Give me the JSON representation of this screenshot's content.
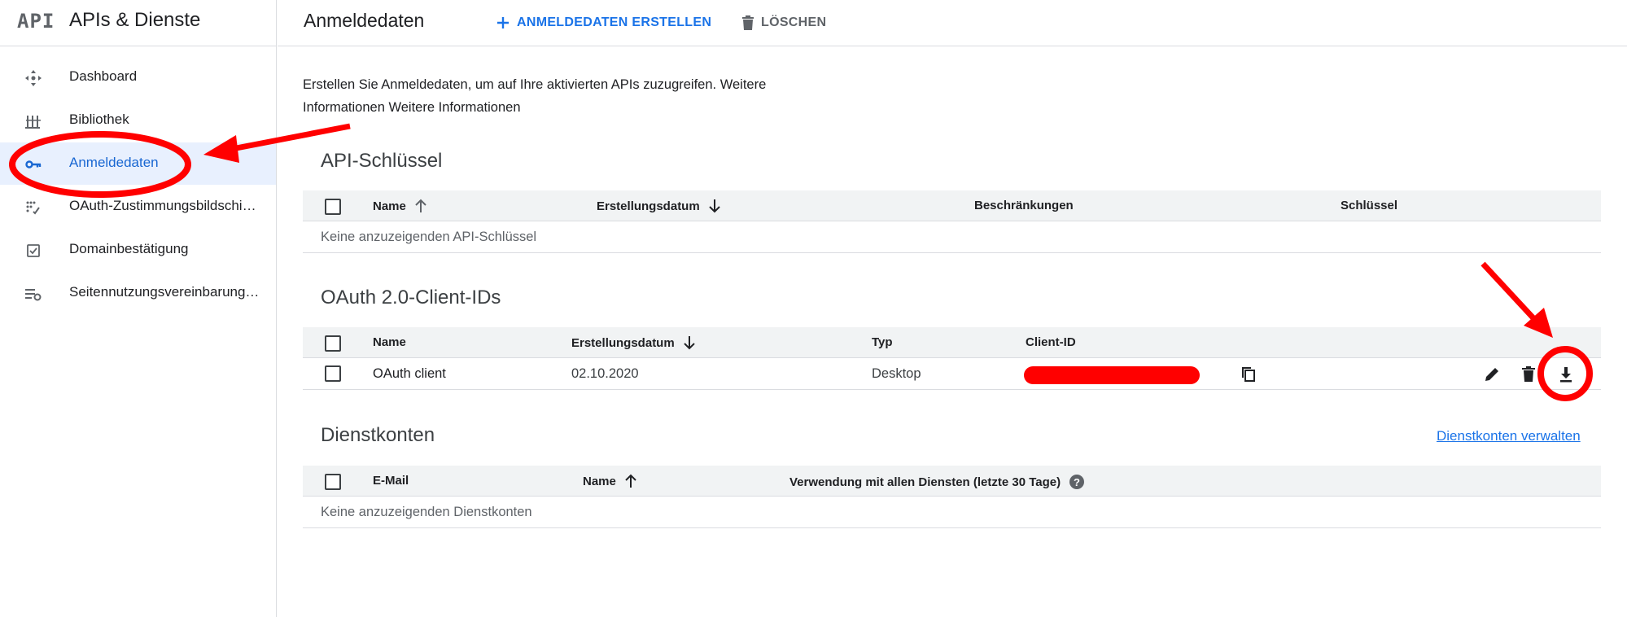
{
  "sidebar": {
    "logo": "API",
    "title": "APIs & Dienste",
    "items": [
      {
        "label": "Dashboard",
        "icon": "dashboard-icon"
      },
      {
        "label": "Bibliothek",
        "icon": "library-icon"
      },
      {
        "label": "Anmeldedaten",
        "icon": "key-icon",
        "active": true
      },
      {
        "label": "OAuth-Zustimmungsbildschi…",
        "icon": "oauth-consent-icon"
      },
      {
        "label": "Domainbestätigung",
        "icon": "checkbox-icon"
      },
      {
        "label": "Seitennutzungsvereinbarung…",
        "icon": "settings-list-icon"
      }
    ]
  },
  "header": {
    "title": "Anmeldedaten",
    "create_label": "ANMELDEDATEN ERSTELLEN",
    "delete_label": "LÖSCHEN"
  },
  "intro_text": "Erstellen Sie Anmeldedaten, um auf Ihre aktivierten APIs zuzugreifen. Weitere Informationen Weitere Informationen",
  "api_keys": {
    "title": "API-Schlüssel",
    "columns": [
      "Name",
      "Erstellungsdatum",
      "Beschränkungen",
      "Schlüssel"
    ],
    "empty_text": "Keine anzuzeigenden API-Schlüssel"
  },
  "oauth": {
    "title": "OAuth 2.0-Client-IDs",
    "columns": [
      "Name",
      "Erstellungsdatum",
      "Typ",
      "Client-ID"
    ],
    "rows": [
      {
        "name": "OAuth client",
        "date": "02.10.2020",
        "type": "Desktop"
      }
    ]
  },
  "service_accounts": {
    "title": "Dienstkonten",
    "manage_link": "Dienstkonten verwalten",
    "columns": [
      "E-Mail",
      "Name",
      "Verwendung mit allen Diensten (letzte 30 Tage)"
    ],
    "empty_text": "Keine anzuzeigenden Dienstkonten"
  },
  "colors": {
    "accent": "#1a73e8",
    "active_bg": "#e8f0fe",
    "annotation": "#ff0000"
  }
}
